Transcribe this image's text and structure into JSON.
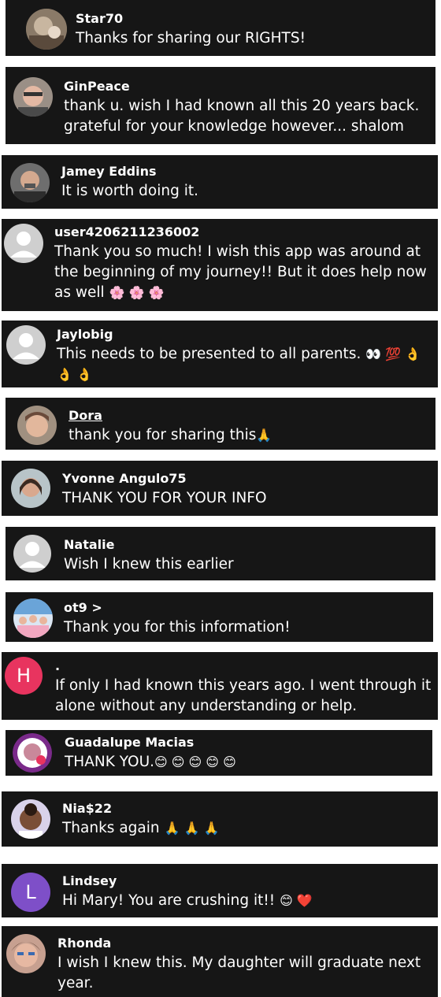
{
  "comments": [
    {
      "username": "Star70",
      "text": "Thanks for sharing our RIGHTS!"
    },
    {
      "username": "GinPeace",
      "text": "thank u. wish I had known all this 20 years back. grateful for your knowledge however... shalom"
    },
    {
      "username": "Jamey Eddins",
      "text": "It is worth doing it."
    },
    {
      "username": "user4206211236002",
      "text": "Thank you so much! I wish this app was around at the beginning of my journey!! But it does help now as well",
      "emoji": "🌸 🌸 🌸"
    },
    {
      "username": "Jaylobig",
      "text": "This needs to be presented to all parents.",
      "emoji": "👀 💯 👌 👌 👌"
    },
    {
      "username": "Dora",
      "text": "thank you for sharing this",
      "emoji": "🙏"
    },
    {
      "username": "Yvonne Angulo75",
      "text": "THANK YOU FOR YOUR INFO"
    },
    {
      "username": "Natalie",
      "text": "Wish I knew this earlier"
    },
    {
      "username": "ot9 >",
      "text": "Thank you for this information!"
    },
    {
      "username": ".",
      "avatar_letter": "H",
      "text": "If only I had known this years ago. I went through it alone without any understanding or help."
    },
    {
      "username": "Guadalupe Macias",
      "text": "THANK YOU.",
      "emoji": "😊 😊 😊 😊 😊"
    },
    {
      "username": "Nia$22",
      "text": "Thanks again",
      "emoji": "🙏 🙏 🙏"
    },
    {
      "username": "Lindsey",
      "avatar_letter": "L",
      "text": "Hi Mary! You are crushing it!!",
      "emoji": "😊 ❤️"
    },
    {
      "username": "Rhonda",
      "text": "I wish I knew this. My daughter will graduate next year."
    }
  ],
  "colors": {
    "card_bg": "#161616",
    "avatar_h": "#e8345f",
    "avatar_l": "#7e4fc8",
    "default_avatar": "#cfcfcf"
  }
}
